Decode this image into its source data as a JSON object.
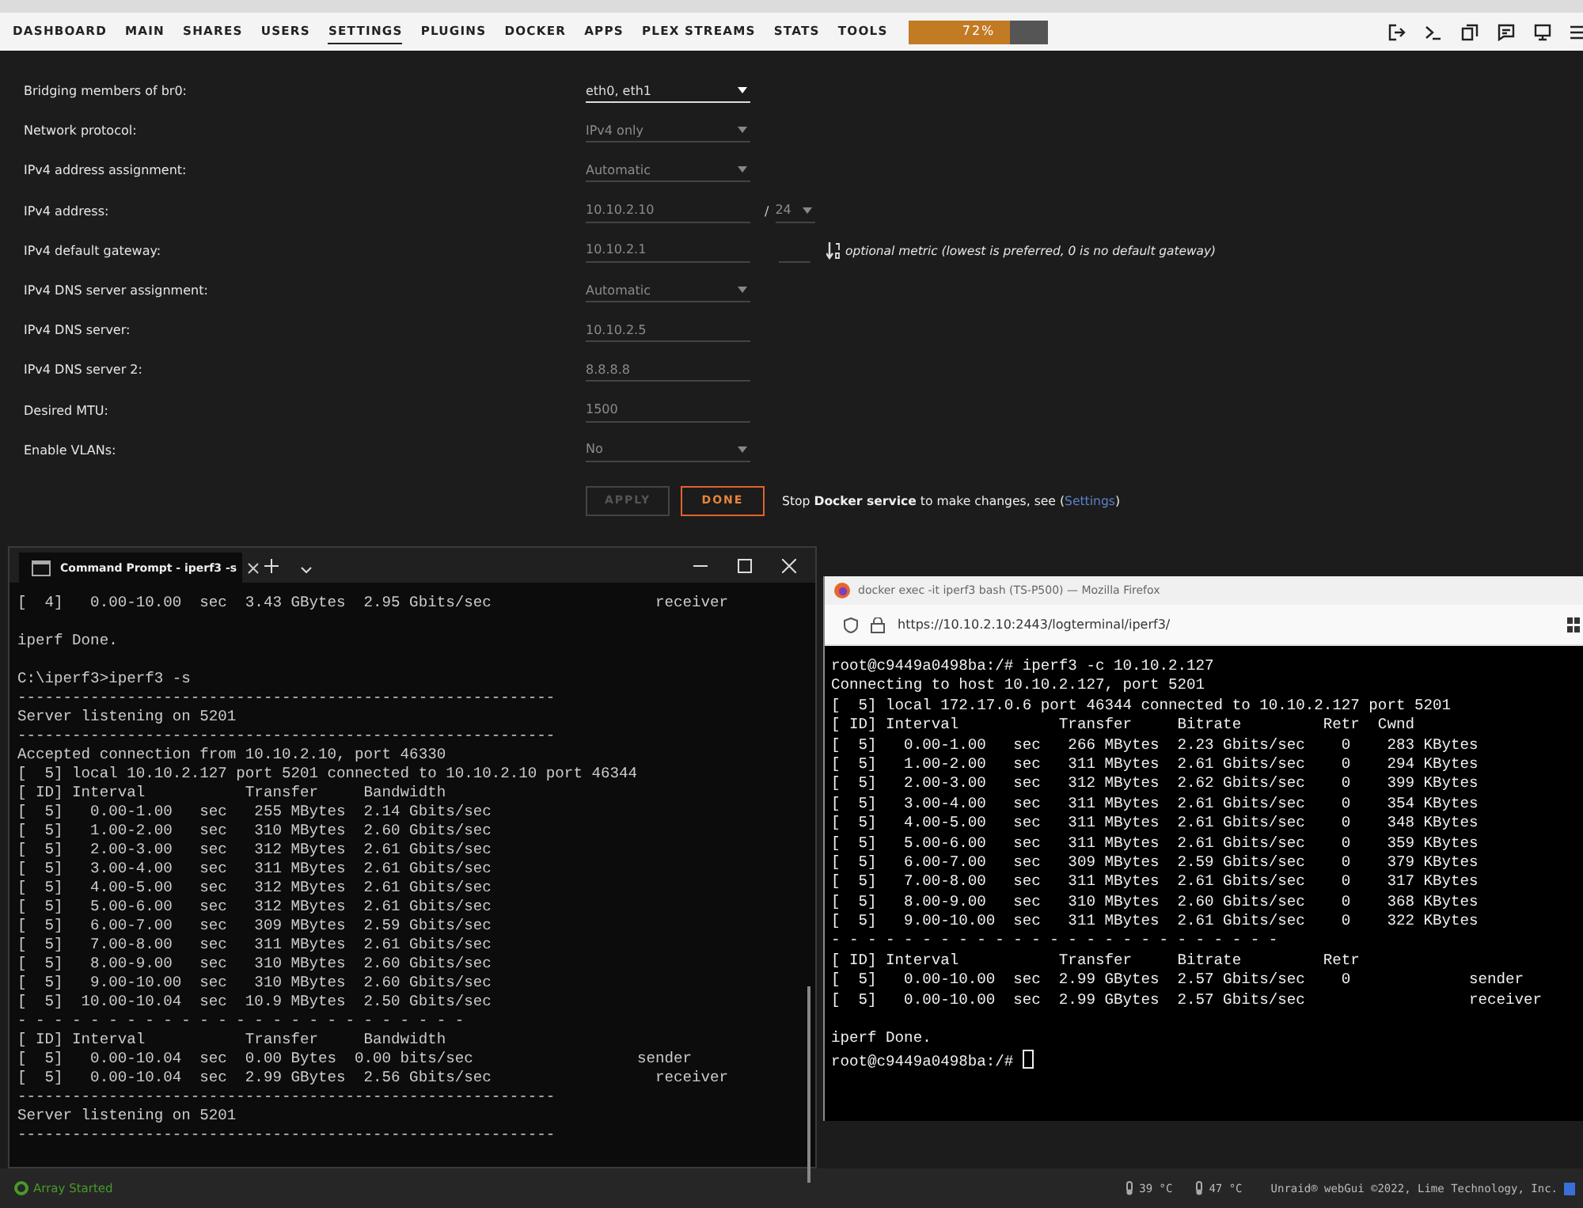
{
  "nav": {
    "items": [
      {
        "label": "DASHBOARD",
        "selected": false
      },
      {
        "label": "MAIN",
        "selected": false
      },
      {
        "label": "SHARES",
        "selected": false
      },
      {
        "label": "USERS",
        "selected": false
      },
      {
        "label": "SETTINGS",
        "selected": true
      },
      {
        "label": "PLUGINS",
        "selected": false
      },
      {
        "label": "DOCKER",
        "selected": false
      },
      {
        "label": "APPS",
        "selected": false
      },
      {
        "label": "PLEX STREAMS",
        "selected": false
      },
      {
        "label": "STATS",
        "selected": false
      },
      {
        "label": "TOOLS",
        "selected": false
      }
    ],
    "usage": {
      "level": 0.72,
      "text": "72%"
    }
  },
  "settings": {
    "rows": [
      {
        "label": "Bridging members of br0:",
        "kind": "select",
        "value": "eth0, eth1",
        "focused": true
      },
      {
        "label": "Network protocol:",
        "kind": "select",
        "value": "IPv4 only",
        "focused": false
      },
      {
        "label": "IPv4 address assignment:",
        "kind": "select",
        "value": "Automatic",
        "focused": false
      },
      {
        "label": "IPv4 address:",
        "kind": "input",
        "value": "10.10.2.10",
        "focused": false,
        "suffix": {
          "kind": "netmask",
          "separator": "/",
          "value": "24"
        }
      },
      {
        "label": "IPv4 default gateway:",
        "kind": "input",
        "value": "10.10.2.1",
        "focused": false,
        "suffix": {
          "kind": "metric",
          "note": "optional metric (lowest is preferred, 0 is no default gateway)"
        }
      },
      {
        "label": "IPv4 DNS server assignment:",
        "kind": "select",
        "value": "Automatic",
        "focused": false
      },
      {
        "label": "IPv4 DNS server:",
        "kind": "input",
        "value": "10.10.2.5",
        "focused": false
      },
      {
        "label": "IPv4 DNS server 2:",
        "kind": "input",
        "value": "8.8.8.8",
        "focused": false
      },
      {
        "label": "Desired MTU:",
        "kind": "input",
        "value": "1500",
        "focused": false
      },
      {
        "label": "Enable VLANs:",
        "kind": "select",
        "value": "No",
        "focused": false
      }
    ],
    "buttons": [
      {
        "label": "APPLY",
        "disabled": true
      },
      {
        "label": "DONE",
        "disabled": false
      }
    ],
    "note": {
      "before": "Stop **Docker service** to make changes, see (",
      "link": "Settings",
      "after": ")"
    }
  },
  "cmd_window": {
    "tab_title": "Command Prompt - iperf3  -s",
    "blocks": [
      [
        "[  4]   0.00-10.00  sec  3.43 GBytes  2.95 Gbits/sec                  receiver"
      ],
      [
        "iperf Done."
      ],
      [
        "C:\\iperf3>iperf3 -s",
        "-----------------------------------------------------------",
        "Server listening on 5201",
        "-----------------------------------------------------------",
        "Accepted connection from 10.10.2.10, port 46330",
        "[  5] local 10.10.2.127 port 5201 connected to 10.10.2.10 port 46344",
        "[ ID] Interval           Transfer     Bandwidth",
        "[  5]   0.00-1.00   sec   255 MBytes  2.14 Gbits/sec",
        "[  5]   1.00-2.00   sec   310 MBytes  2.60 Gbits/sec",
        "[  5]   2.00-3.00   sec   312 MBytes  2.61 Gbits/sec",
        "[  5]   3.00-4.00   sec   311 MBytes  2.61 Gbits/sec",
        "[  5]   4.00-5.00   sec   312 MBytes  2.61 Gbits/sec",
        "[  5]   5.00-6.00   sec   312 MBytes  2.61 Gbits/sec",
        "[  5]   6.00-7.00   sec   309 MBytes  2.59 Gbits/sec",
        "[  5]   7.00-8.00   sec   311 MBytes  2.61 Gbits/sec",
        "[  5]   8.00-9.00   sec   310 MBytes  2.60 Gbits/sec",
        "[  5]   9.00-10.00  sec   310 MBytes  2.60 Gbits/sec",
        "[  5]  10.00-10.04  sec  10.9 MBytes  2.50 Gbits/sec",
        "- - - - - - - - - - - - - - - - - - - - - - - - -",
        "[ ID] Interval           Transfer     Bandwidth",
        "[  5]   0.00-10.04  sec  0.00 Bytes  0.00 bits/sec                  sender",
        "[  5]   0.00-10.04  sec  2.99 GBytes  2.56 Gbits/sec                  receiver",
        "-----------------------------------------------------------",
        "Server listening on 5201",
        "-----------------------------------------------------------"
      ]
    ]
  },
  "browser_window": {
    "title": "docker exec -it iperf3 bash (TS-P500) — Mozilla Firefox",
    "url": "https://10.10.2.10:2443/logterminal/iperf3/",
    "cursor": true,
    "blocks": [
      [
        "root@c9449a0498ba:/# iperf3 -c 10.10.2.127",
        "Connecting to host 10.10.2.127, port 5201",
        "[  5] local 172.17.0.6 port 46344 connected to 10.10.2.127 port 5201",
        "[ ID] Interval           Transfer     Bitrate         Retr  Cwnd",
        "[  5]   0.00-1.00   sec   266 MBytes  2.23 Gbits/sec    0    283 KBytes",
        "[  5]   1.00-2.00   sec   311 MBytes  2.61 Gbits/sec    0    294 KBytes",
        "[  5]   2.00-3.00   sec   312 MBytes  2.62 Gbits/sec    0    399 KBytes",
        "[  5]   3.00-4.00   sec   311 MBytes  2.61 Gbits/sec    0    354 KBytes",
        "[  5]   4.00-5.00   sec   311 MBytes  2.61 Gbits/sec    0    348 KBytes",
        "[  5]   5.00-6.00   sec   311 MBytes  2.61 Gbits/sec    0    359 KBytes",
        "[  5]   6.00-7.00   sec   309 MBytes  2.59 Gbits/sec    0    379 KBytes",
        "[  5]   7.00-8.00   sec   311 MBytes  2.61 Gbits/sec    0    317 KBytes",
        "[  5]   8.00-9.00   sec   310 MBytes  2.60 Gbits/sec    0    368 KBytes",
        "[  5]   9.00-10.00  sec   311 MBytes  2.61 Gbits/sec    0    322 KBytes",
        "- - - - - - - - - - - - - - - - - - - - - - - - -",
        "[ ID] Interval           Transfer     Bitrate         Retr",
        "[  5]   0.00-10.00  sec  2.99 GBytes  2.57 Gbits/sec    0             sender",
        "[  5]   0.00-10.00  sec  2.99 GBytes  2.57 Gbits/sec                  receiver"
      ],
      [
        "iperf Done.",
        "root@c9449a0498ba:/#"
      ]
    ]
  },
  "status_bar": {
    "array_status": "Array Started",
    "temps": [
      "39 °C",
      "47 °C"
    ],
    "copyright": "Unraid® webGui ©2022, Lime Technology, Inc."
  }
}
